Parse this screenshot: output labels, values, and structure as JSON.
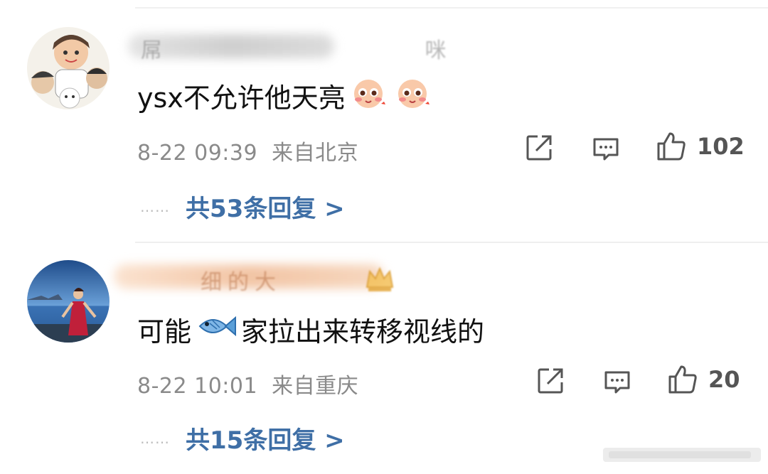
{
  "comments": [
    {
      "username_visible": "屌 咪",
      "text": "ysx不允许他天亮",
      "emojis": [
        "blushing-face-emoji",
        "blushing-face-emoji"
      ],
      "time": "8-22 09:39",
      "location": "来自北京",
      "likes": "102",
      "replies_label": "共53条回复 >",
      "dots": "……"
    },
    {
      "username_visible": "细的大",
      "text_before": "可能",
      "text_after": "家拉出来转移视线的",
      "emoji": "fish-emoji",
      "time": "8-22 10:01",
      "location": "来自重庆",
      "likes": "20",
      "replies_label": "共15条回复 >",
      "dots": "……"
    }
  ],
  "icons": [
    "share-icon",
    "comment-icon",
    "like-icon"
  ],
  "colors": {
    "link": "#3f6fa6",
    "meta": "#8a8a8a",
    "text": "#111111"
  }
}
